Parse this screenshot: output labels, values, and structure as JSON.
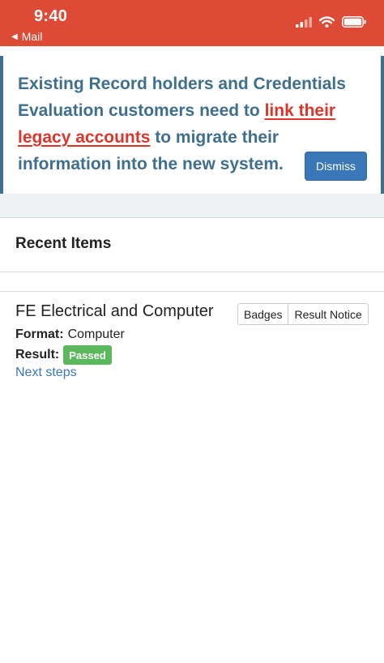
{
  "status_bar": {
    "time": "9:40",
    "back_label": "Mail",
    "icons": [
      "signal-icon",
      "wifi-icon",
      "battery-icon"
    ]
  },
  "banner": {
    "text_before": "Existing Record holders and Credentials Evaluation customers need to ",
    "link_text": "link their legacy accounts",
    "text_after": " to migrate their information into the new system.",
    "dismiss_label": "Dismiss"
  },
  "recent": {
    "title": "Recent Items"
  },
  "item": {
    "title": "FE Electrical and Computer",
    "badges_label": "Badges",
    "result_notice_label": "Result Notice",
    "format_label": "Format:",
    "format_value": "Computer",
    "result_label": "Result:",
    "result_value": "Passed",
    "next_steps_label": "Next steps"
  },
  "colors": {
    "status_bar": "#dd4a35",
    "banner_text": "#3e6f8e",
    "banner_link": "#d9362c",
    "dismiss_button": "#3a77b8",
    "passed_badge": "#5cb85c",
    "link": "#3a77b8"
  }
}
